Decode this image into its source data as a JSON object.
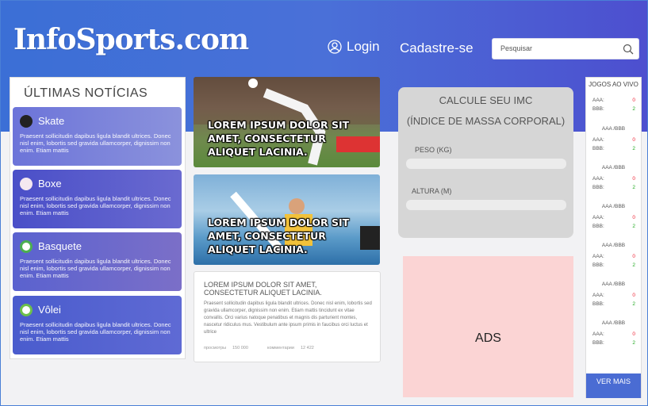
{
  "header": {
    "logo": "InfoSports.com",
    "login_label": "Login",
    "signup_label": "Cadastre-se",
    "search_placeholder": "Pesquisar"
  },
  "news": {
    "title": "ÚLTIMAS NOTÍCIAS",
    "items": [
      {
        "label": "Skate",
        "text": "Praesent sollicitudin dapibus ligula blandit ultrices. Donec nisl enim, lobortis sed gravida ullamcorper, dignissim non enim. Etiam mattis",
        "color": "#6a72d8"
      },
      {
        "label": "Boxe",
        "text": "Praesent sollicitudin dapibus ligula blandit ultrices. Donec nisl enim, lobortis sed gravida ullamcorper, dignissim non enim. Etiam mattis",
        "color": "#4f4fc6"
      },
      {
        "label": "Basquete",
        "text": "Praesent sollicitudin dapibus ligula blandit ultrices. Donec nisl enim, lobortis sed gravida ullamcorper, dignissim non enim. Etiam mattis",
        "color": "#5a62cf"
      },
      {
        "label": "Vôlei",
        "text": "Praesent sollicitudin dapibus ligula blandit ultrices. Donec nisl enim, lobortis sed gravida ullamcorper, dignissim non enim. Etiam mattis",
        "color": "#4b5bcc"
      }
    ]
  },
  "featured": [
    {
      "caption": "LOREM IPSUM DOLOR SIT AMET, CONSECTETUR ALIQUET LACINIA."
    },
    {
      "caption": "LOREM IPSUM DOLOR SIT AMET, CONSECTETUR ALIQUET LACINIA."
    }
  ],
  "article": {
    "title": "LOREM IPSUM DOLOR SIT AMET, CONSECTETUR ALIQUET LACINIA.",
    "body": "Praesent sollicitudin dapibus ligula blandit ultrices. Donec nisl enim, lobortis sed gravida ullamcorper, dignissim non enim. Etiam mattis tincidunt ex vitae convallis. Orci varius natoque penatibus et magnis dis parturient montes, nascetur ridiculus mus. Vestibulum ante ipsum primis in faucibus orci luctus et ultrice",
    "views_label": "просмотры",
    "views_value": "150 000",
    "comments_label": "комментарии",
    "comments_value": "12 422"
  },
  "imc": {
    "title_line1": "CALCULE SEU IMC",
    "title_line2": "(ÍNDICE DE MASSA CORPORAL)",
    "weight_label": "PESO (KG)",
    "height_label": "ALTURA (M)"
  },
  "ads": {
    "label": "ADS"
  },
  "live": {
    "title": "JOGOS AO VIVO",
    "more_label": "VER MAIS",
    "games": [
      {
        "header": "",
        "team_a": "AAA:",
        "score_a": "0",
        "team_b": "BBB:",
        "score_b": "2"
      },
      {
        "header": "AAA /BBB",
        "team_a": "AAA:",
        "score_a": "0",
        "team_b": "BBB:",
        "score_b": "2"
      },
      {
        "header": "AAA /BBB",
        "team_a": "AAA:",
        "score_a": "0",
        "team_b": "BBB:",
        "score_b": "2"
      },
      {
        "header": "AAA /BBB",
        "team_a": "AAA:",
        "score_a": "0",
        "team_b": "BBB:",
        "score_b": "2"
      },
      {
        "header": "AAA /BBB",
        "team_a": "AAA:",
        "score_a": "0",
        "team_b": "BBB:",
        "score_b": "2"
      },
      {
        "header": "AAA /BBB",
        "team_a": "AAA:",
        "score_a": "0",
        "team_b": "BBB:",
        "score_b": "2"
      },
      {
        "header": "AAA /BBB",
        "team_a": "AAA:",
        "score_a": "0",
        "team_b": "BBB:",
        "score_b": "2"
      }
    ]
  }
}
